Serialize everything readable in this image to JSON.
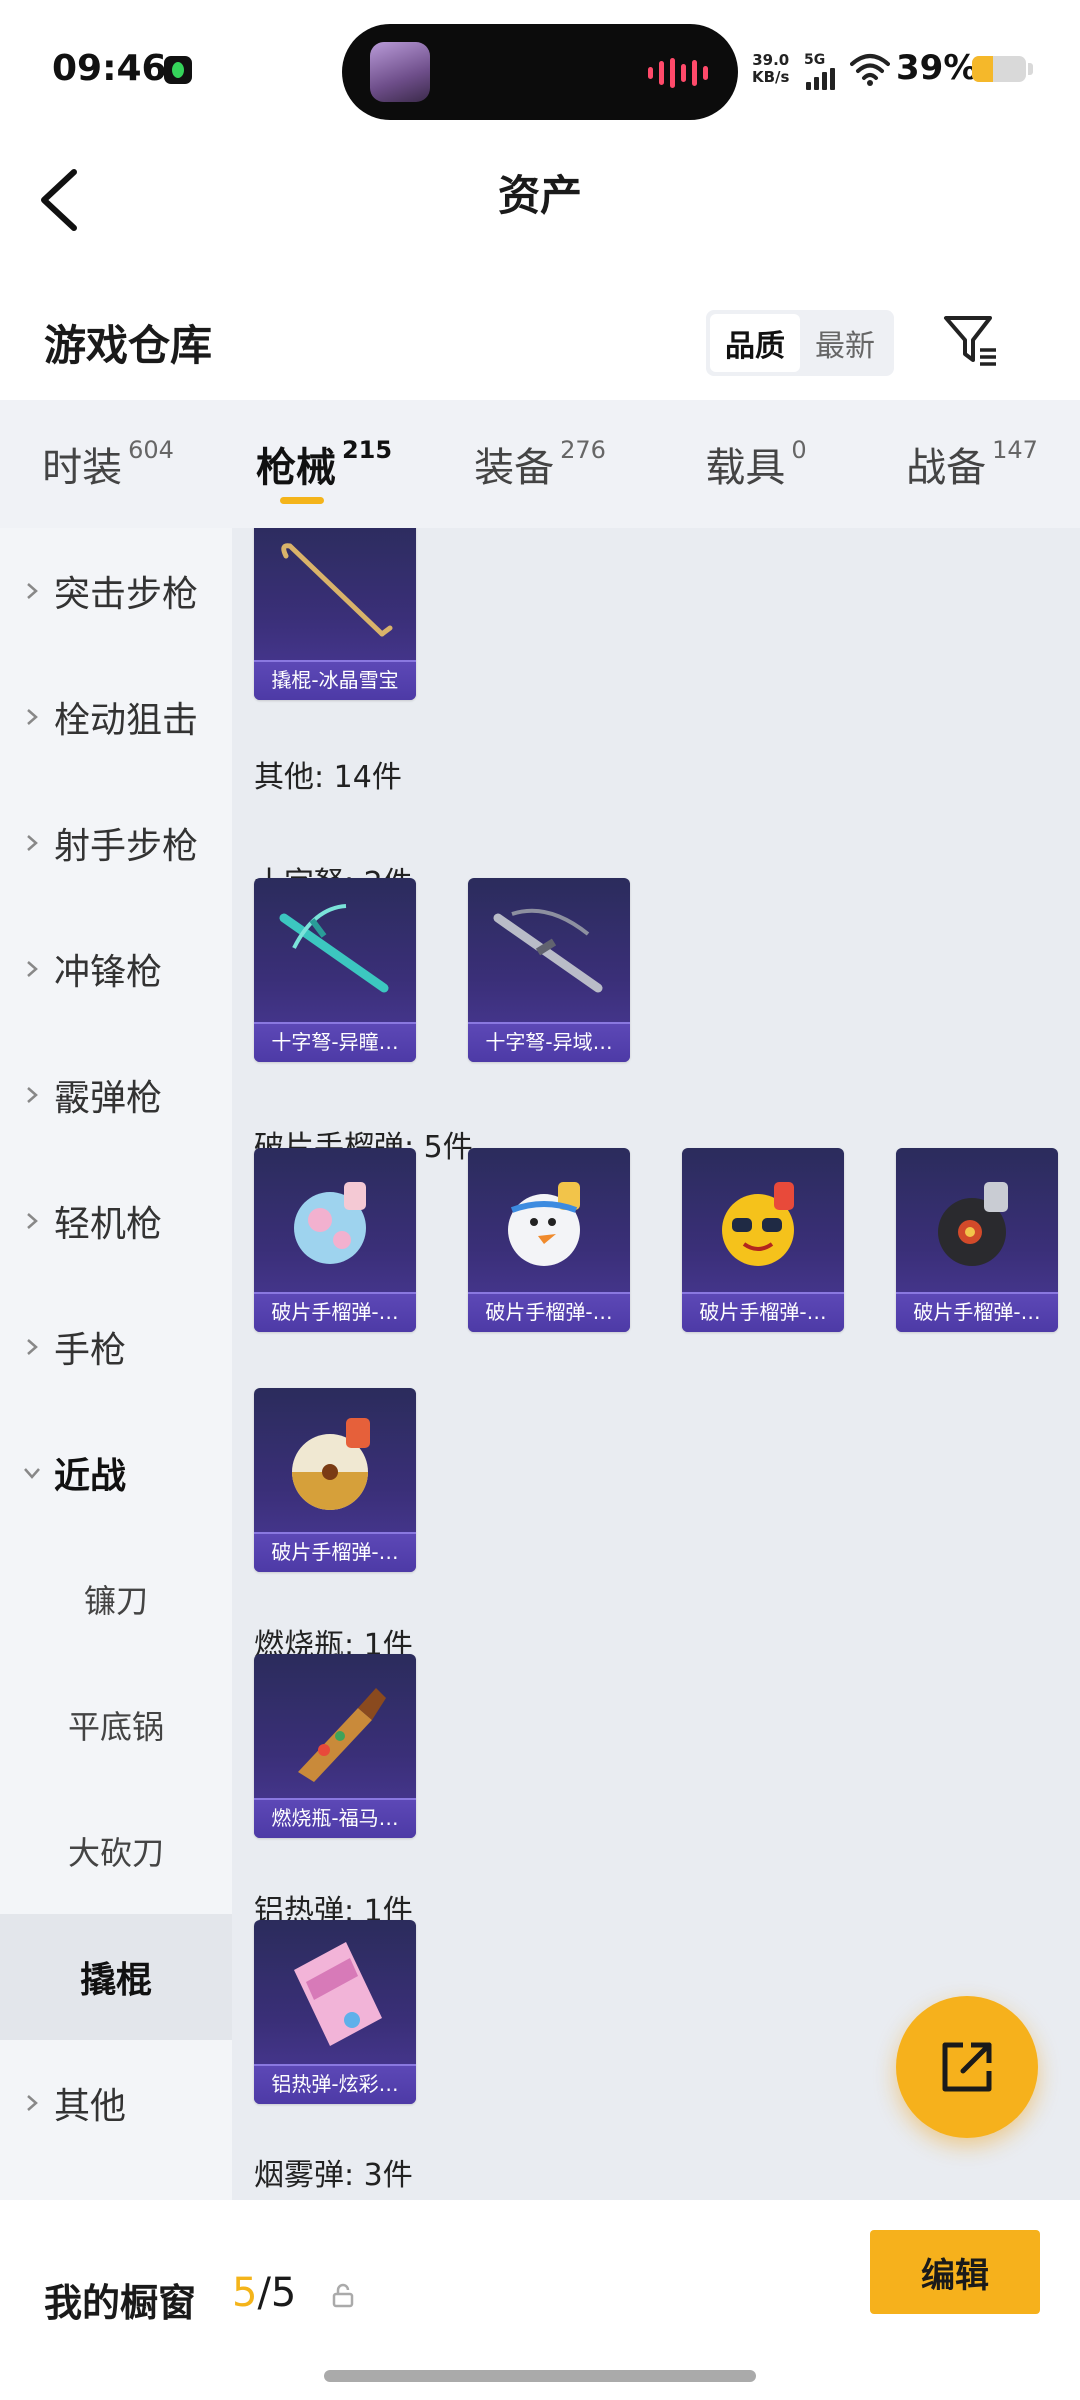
{
  "status_bar": {
    "time": "09:46",
    "net_speed_value": "39.0",
    "net_speed_unit": "KB/s",
    "network_type": "5G",
    "battery_percent": "39%",
    "battery_level": 0.39
  },
  "header": {
    "title": "资产"
  },
  "warehouse": {
    "title": "游戏仓库",
    "sort_options": [
      "品质",
      "最新"
    ],
    "sort_selected": "品质"
  },
  "tabs": [
    {
      "label": "时装",
      "count": "604"
    },
    {
      "label": "枪械",
      "count": "215",
      "active": true
    },
    {
      "label": "装备",
      "count": "276"
    },
    {
      "label": "载具",
      "count": "0"
    },
    {
      "label": "战备",
      "count": "147"
    }
  ],
  "sidebar": {
    "items": [
      {
        "label": "突击步枪"
      },
      {
        "label": "栓动狙击"
      },
      {
        "label": "射手步枪"
      },
      {
        "label": "冲锋枪"
      },
      {
        "label": "霰弹枪"
      },
      {
        "label": "轻机枪"
      },
      {
        "label": "手枪"
      },
      {
        "label": "近战",
        "expanded": true
      },
      {
        "label": "镰刀"
      },
      {
        "label": "平底锅"
      },
      {
        "label": "大砍刀"
      },
      {
        "label": "撬棍",
        "selected": true
      },
      {
        "label": "其他"
      }
    ]
  },
  "content": {
    "top_card": {
      "name": "撬棍-冰晶雪宝"
    },
    "groups": [
      {
        "label": "其他: 14件"
      },
      {
        "label": "十字弩: 2件"
      },
      {
        "label": "破片手榴弹: 5件"
      },
      {
        "label": "燃烧瓶: 1件"
      },
      {
        "label": "铝热弹: 1件"
      },
      {
        "label": "烟雾弹: 3件"
      }
    ],
    "crossbow_cards": [
      {
        "name": "十字弩-异瞳…"
      },
      {
        "name": "十字弩-异域…"
      }
    ],
    "grenade_cards": [
      {
        "name": "破片手榴弹-…"
      },
      {
        "name": "破片手榴弹-…"
      },
      {
        "name": "破片手榴弹-…"
      },
      {
        "name": "破片手榴弹-…"
      },
      {
        "name": "破片手榴弹-…"
      }
    ],
    "molotov_card": {
      "name": "燃烧瓶-福马…"
    },
    "thermite_card": {
      "name": "铝热弹-炫彩…"
    }
  },
  "bottom_bar": {
    "showcase_label": "我的橱窗",
    "showcase_current": "5",
    "showcase_total": "/5",
    "edit_label": "编辑"
  },
  "colors": {
    "accent": "#f6b11c",
    "card_bg": "#3a2f78",
    "card_label": "#5d49b7",
    "content_bg": "#e9ecf1",
    "sidebar_bg": "#f3f5f8"
  }
}
